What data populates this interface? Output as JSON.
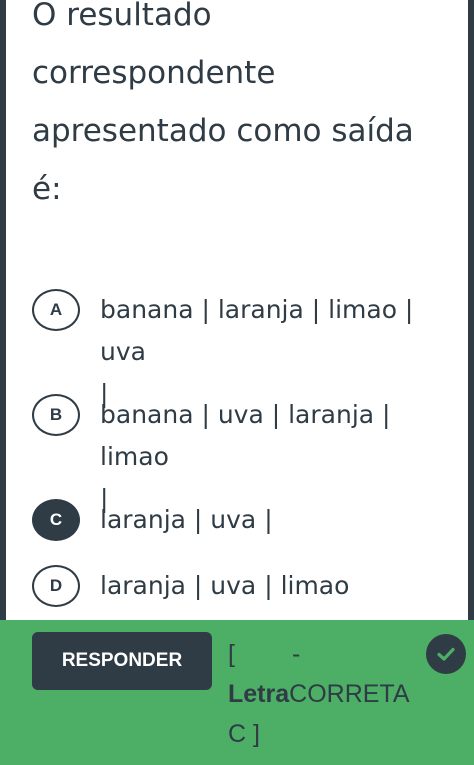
{
  "question": {
    "lines": [
      "O resultado",
      "correspondente",
      "apresentado como saída",
      "é:"
    ]
  },
  "options": [
    {
      "letter": "A",
      "line1": "banana | laranja | limao | uva",
      "line2": "|",
      "selected": false
    },
    {
      "letter": "B",
      "line1": "banana | uva | laranja | limao",
      "line2": "|",
      "selected": false
    },
    {
      "letter": "C",
      "line1": "laranja | uva |",
      "line2": "",
      "selected": true
    },
    {
      "letter": "D",
      "line1": "laranja | uva | limao",
      "line2": "",
      "selected": false
    }
  ],
  "footer": {
    "button_label": "RESPONDER",
    "answer": {
      "open_bracket": "[",
      "dash": "-",
      "letra": "Letra",
      "correta": "CORRETA",
      "close": "C ]"
    },
    "check_icon": "checkmark-circle-icon"
  },
  "colors": {
    "dark": "#2f3b45",
    "green": "#4dae66",
    "white": "#ffffff"
  }
}
